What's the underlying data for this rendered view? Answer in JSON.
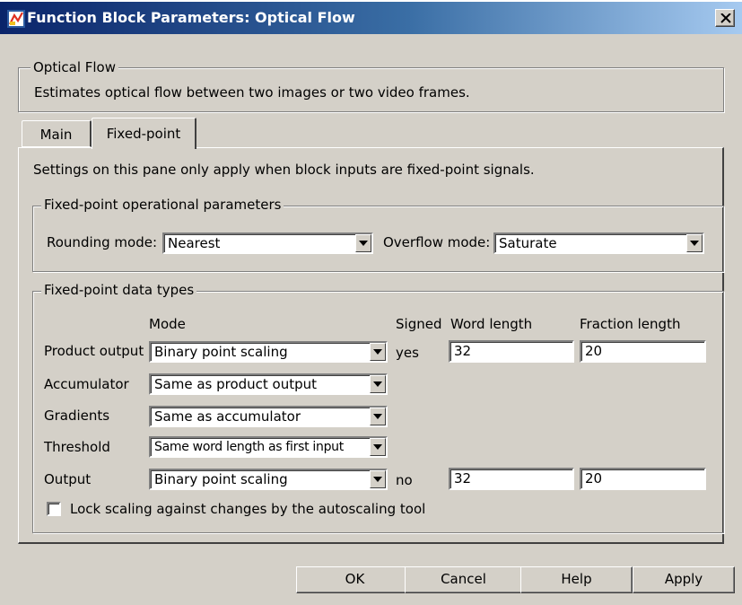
{
  "window": {
    "title": "Function Block Parameters: Optical Flow",
    "close_label": "×"
  },
  "block_group": {
    "legend": "Optical Flow",
    "description": "Estimates optical flow between two images or two video frames."
  },
  "tabs": [
    {
      "label": "Main",
      "selected": false
    },
    {
      "label": "Fixed-point",
      "selected": true
    }
  ],
  "fixed_point": {
    "note": "Settings on this pane only apply when block inputs are fixed-point signals.",
    "operational": {
      "legend": "Fixed-point operational parameters",
      "rounding_label": "Rounding mode:",
      "rounding_value": "Nearest",
      "overflow_label": "Overflow mode:",
      "overflow_value": "Saturate"
    },
    "data_types": {
      "legend": "Fixed-point data types",
      "headers": {
        "mode": "Mode",
        "signed": "Signed",
        "word_length": "Word length",
        "fraction_length": "Fraction length"
      },
      "rows": [
        {
          "label": "Product output",
          "mode": "Binary point scaling",
          "signed": "yes",
          "word_length": "32",
          "fraction_length": "20"
        },
        {
          "label": "Accumulator",
          "mode": "Same as product output"
        },
        {
          "label": "Gradients",
          "mode": "Same as accumulator"
        },
        {
          "label": "Threshold",
          "mode": "Same word length as first input"
        },
        {
          "label": "Output",
          "mode": "Binary point scaling",
          "signed": "no",
          "word_length": "32",
          "fraction_length": "20"
        }
      ],
      "lock_scaling_label": "Lock scaling against changes by the autoscaling tool",
      "lock_scaling_checked": false
    }
  },
  "buttons": {
    "ok": "OK",
    "cancel": "Cancel",
    "help": "Help",
    "apply": "Apply"
  },
  "colors": {
    "titlebar_start": "#0a246a",
    "titlebar_end": "#a6caf0",
    "dialog_face": "#d4d0c8"
  },
  "icons": {
    "app": "simulink-block-icon",
    "close": "close-icon",
    "dropdown": "chevron-down-icon"
  }
}
